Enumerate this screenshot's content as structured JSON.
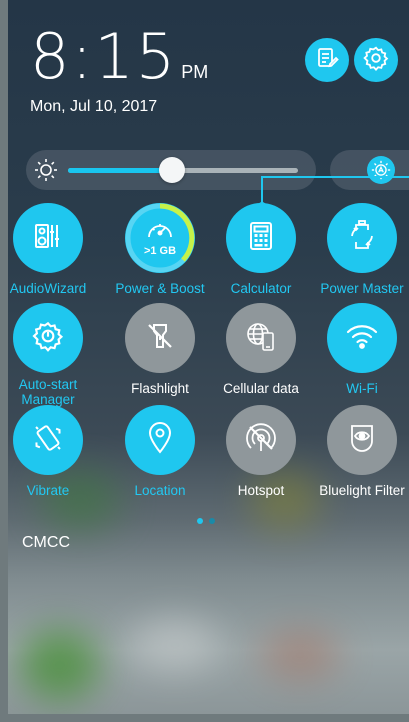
{
  "status": {
    "time": "8:15",
    "ampm": "PM",
    "date": "Mon, Jul 10, 2017"
  },
  "top_actions": [
    {
      "icon": "edit-icon"
    },
    {
      "icon": "settings-icon"
    }
  ],
  "brightness": {
    "level": 0.45,
    "icon": "sun-icon",
    "auto_icon": "auto-brightness-icon"
  },
  "tiles": [
    {
      "label": "AudioWizard",
      "icon": "audiowizard-icon",
      "state": "on"
    },
    {
      "label": "Power & Boost",
      "icon": "speedometer-icon",
      "state": "on",
      "badge": ">1 GB"
    },
    {
      "label": "Calculator",
      "icon": "calculator-icon",
      "state": "on"
    },
    {
      "label": "Power Master",
      "icon": "battery-icon",
      "state": "on"
    },
    {
      "label": "Auto-start Manager",
      "icon": "gear-icon",
      "state": "on"
    },
    {
      "label": "Flashlight",
      "icon": "flashlight-off-icon",
      "state": "off"
    },
    {
      "label": "Cellular data",
      "icon": "cellular-data-icon",
      "state": "off"
    },
    {
      "label": "Wi-Fi",
      "icon": "wifi-icon",
      "state": "on"
    },
    {
      "label": "Vibrate",
      "icon": "vibrate-icon",
      "state": "on"
    },
    {
      "label": "Location",
      "icon": "location-icon",
      "state": "on"
    },
    {
      "label": "Hotspot",
      "icon": "hotspot-off-icon",
      "state": "off"
    },
    {
      "label": "Bluelight Filter",
      "icon": "bluelight-filter-icon",
      "state": "off"
    }
  ],
  "pager": {
    "pages": 2,
    "current": 1
  },
  "carrier": "CMCC",
  "colors": {
    "accent": "#1fc7ef",
    "tile_off": "#8f979b",
    "label_on": "#22c8f2",
    "label_off": "#ffffff"
  }
}
